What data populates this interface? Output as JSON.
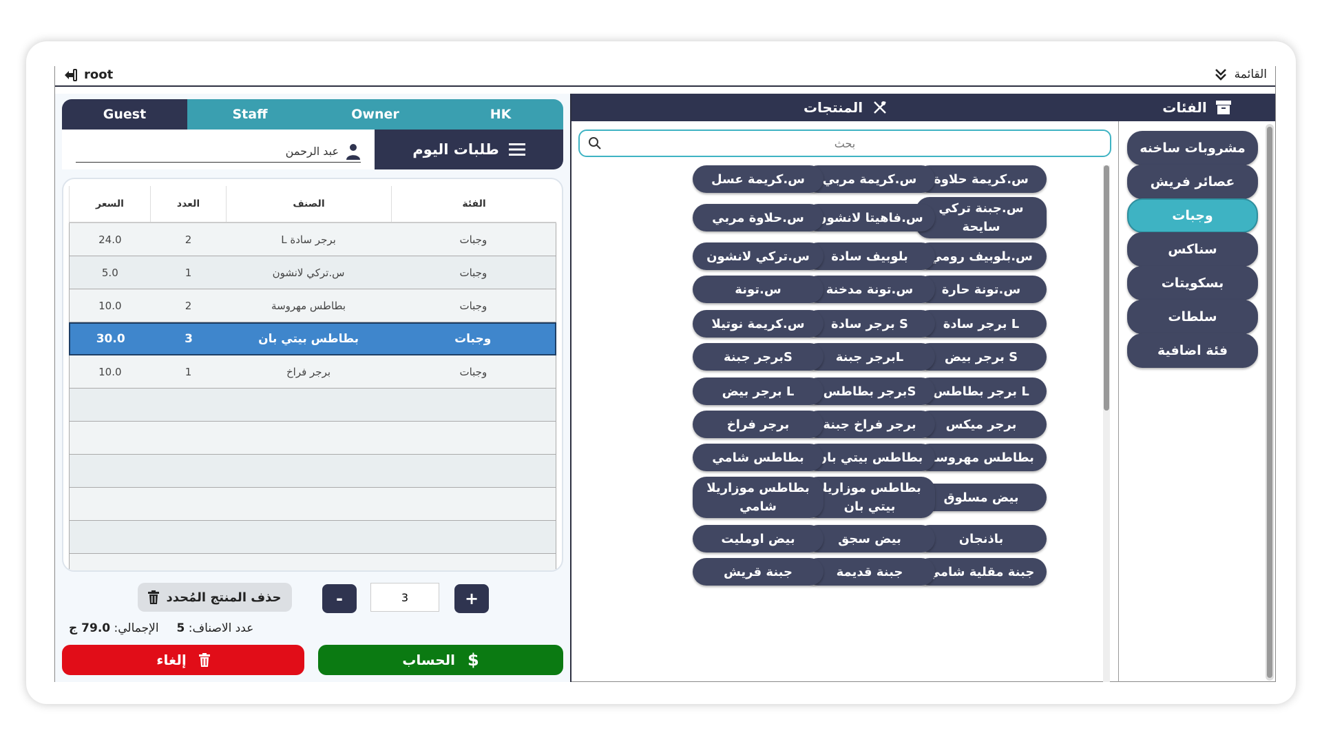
{
  "topbar": {
    "menu_label": "القائمة",
    "user_name": "root"
  },
  "categories": {
    "title": "الفئات",
    "items": [
      "مشروبات ساخنه",
      "عصائر فريش",
      "وجبات",
      "سناكس",
      "بسكويتات",
      "سلطات",
      "فئة اضافية"
    ],
    "active_index": 2
  },
  "products": {
    "title": "المنتجات",
    "search_placeholder": "بحث",
    "items": [
      "س.كريمة حلاوة",
      "س.كريمة مربي",
      "س.كريمة عسل",
      "س.جبنة تركي سايحة",
      "س.فاهيتا لانشون",
      "س.حلاوة مربي",
      "س.بلوبيف رومي",
      "بلوبيف سادة",
      "س.تركي لانشون",
      "س.تونة حارة",
      "س.تونة مدخنة",
      "س.تونة",
      "برجر سادة L",
      "برجر سادة S",
      "س.كريمة نوتيلا",
      "برجر بيض S",
      "برجر جبنةL",
      "برجر جبنةS",
      "برجر بطاطس L",
      "برجر بطاطسS",
      "برجر بيض L",
      "برجر ميكس",
      "برجر فراخ جبنة",
      "برجر فراخ",
      "بطاطس مهروسة",
      "بطاطس بيتي بان",
      "بطاطس شامي",
      "بيض مسلوق",
      "بطاطس موزاريلا بيتي بان",
      "بطاطس موزاريلا شامي",
      "باذنجان",
      "بيض سجق",
      "بيض اومليت",
      "جبنة مقلية شامي",
      "جبنة قديمة",
      "جبنة قريش"
    ]
  },
  "order": {
    "tabs": [
      "Guest",
      "Staff",
      "Owner",
      "HK"
    ],
    "today_label": "طلبات اليوم",
    "customer_name": "عبد الرحمن",
    "headers": {
      "category": "الفئة",
      "item": "الصنف",
      "count": "العدد",
      "price": "السعر"
    },
    "rows": [
      {
        "category": "وجبات",
        "item": "برجر سادة L",
        "count": "2",
        "price": "24.0"
      },
      {
        "category": "وجبات",
        "item": "س.تركي لانشون",
        "count": "1",
        "price": "5.0"
      },
      {
        "category": "وجبات",
        "item": "بطاطس مهروسة",
        "count": "2",
        "price": "10.0"
      },
      {
        "category": "وجبات",
        "item": "بطاطس بيتي بان",
        "count": "3",
        "price": "30.0"
      },
      {
        "category": "وجبات",
        "item": "برجر فراخ",
        "count": "1",
        "price": "10.0"
      }
    ],
    "selected_row": 3,
    "delete_label": "حذف المنتج المُحدد",
    "quantity": "3",
    "minus_label": "-",
    "plus_label": "+",
    "items_count_label": "عدد الاصناف:",
    "items_count": "5",
    "total_label": "الإجمالي:",
    "total_value": "79.0 ج",
    "cancel_label": "إلغاء",
    "pay_label": "الحساب"
  },
  "colors": {
    "navy": "#2f3450",
    "teal": "#3eb3c3",
    "selected_row": "#3f86cc",
    "cancel": "#e10d18",
    "pay": "#0b7a12"
  }
}
